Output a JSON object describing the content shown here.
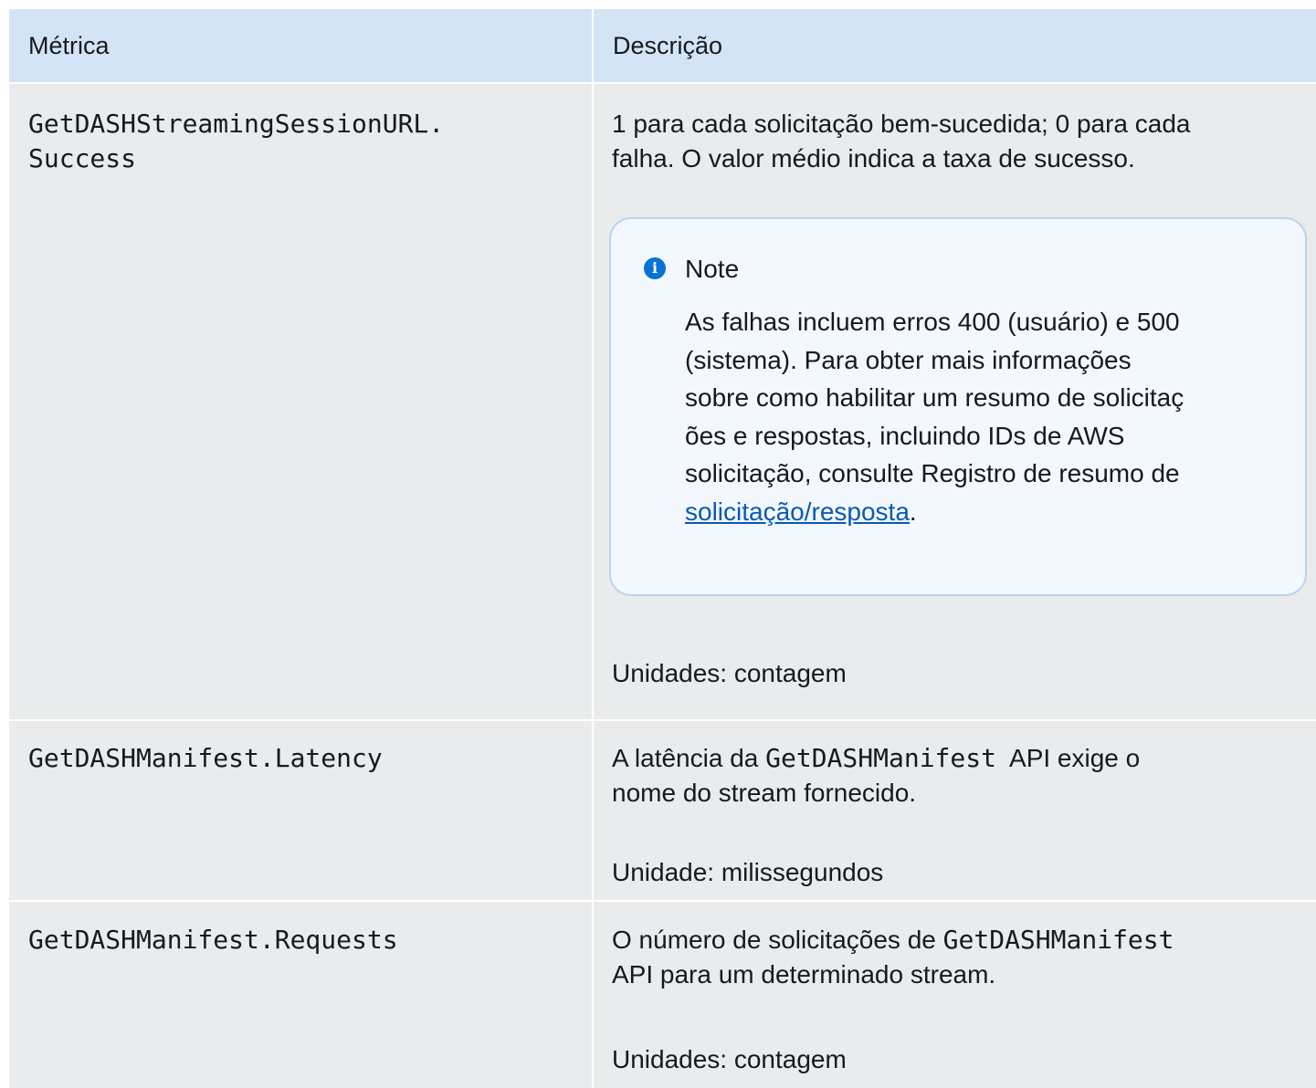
{
  "table": {
    "headers": [
      "Métrica",
      "Descrição"
    ],
    "rows": [
      {
        "metric": "GetDASHStreamingSessionURL.Success",
        "metric_line1": "GetDASHStreamingSessionURL.",
        "metric_line2": "Success",
        "desc_line1": "1 para cada solicitação bem-sucedida; 0 para cada",
        "desc_line2": "falha. O valor médio indica a taxa de sucesso.",
        "note": {
          "title": "Note",
          "lines": [
            "As falhas incluem erros 400 (usuário) e 500",
            "(sistema). Para obter mais informações",
            "sobre como habilitar um resumo de solicitaç",
            "ões e respostas, incluindo IDs de AWS",
            "solicitação, consulte Registro de resumo de"
          ],
          "link": "solicitação/resposta",
          "after_link": "."
        },
        "units": "Unidades: contagem"
      },
      {
        "metric": "GetDASHManifest.Latency",
        "desc_prefix": "A latência da ",
        "desc_code": "GetDASHManifest",
        "desc_suffix": "  API exige o",
        "desc_line2": "nome do stream fornecido.",
        "units": "Unidade: milissegundos"
      },
      {
        "metric": "GetDASHManifest.Requests",
        "desc_prefix": "O número de solicitações de ",
        "desc_code": "GetDASHManifest",
        "desc_line2": "API para um determinado stream.",
        "units": "Unidades: contagem"
      }
    ]
  },
  "colors": {
    "header_bg": "#d3e4f7",
    "cell_bg": "#e9ebed",
    "note_bg": "#f2f8fd",
    "note_border": "#b9d4f0",
    "info_icon": "#0972d3",
    "link": "#0a58b5"
  },
  "icons": {
    "note": "info-circle-icon"
  }
}
